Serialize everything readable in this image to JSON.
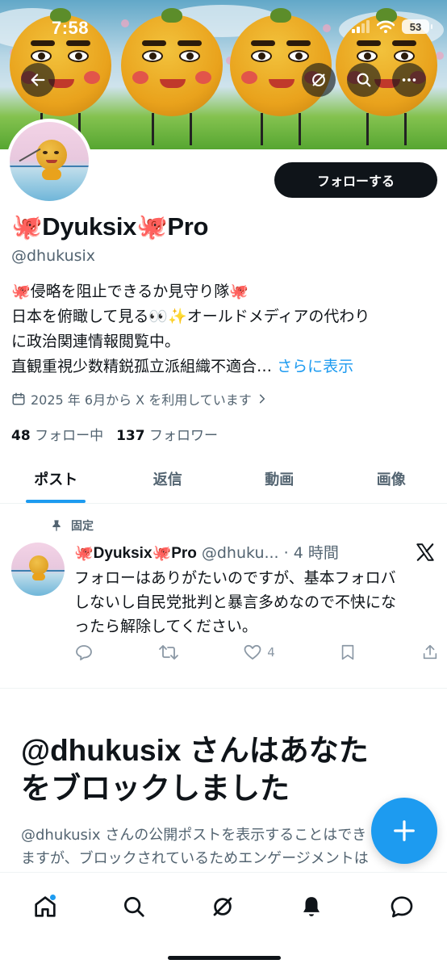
{
  "status_bar": {
    "time": "7:58",
    "battery": "53"
  },
  "profile": {
    "display_name": "🐙Dyuksix🐙Pro",
    "handle": "@dhukusix",
    "follow_label": "フォローする",
    "bio_lines": [
      "🐙侵略を阻止できるか見守り隊🐙",
      "日本を俯瞰して見る👀✨オールドメディアの代わり",
      "に政治関連情報閲覧中。",
      "直観重視少数精鋭孤立派組織不適合…"
    ],
    "bio_more": "さらに表示",
    "joined": "2025 年 6月から X を利用しています",
    "following_count": "48",
    "following_label": "フォロー中",
    "followers_count": "137",
    "followers_label": "フォロワー"
  },
  "tabs": [
    {
      "label": "ポスト",
      "active": true
    },
    {
      "label": "返信",
      "active": false
    },
    {
      "label": "動画",
      "active": false
    },
    {
      "label": "画像",
      "active": false
    }
  ],
  "pinned_post": {
    "pinned_label": "固定",
    "name": "🐙Dyuksix🐙Pro",
    "handle": "@dhuku...",
    "time": "· 4 時間",
    "text_lines": [
      "フォローはありがたいのですが、基本フォロバ",
      "しないし自民党批判と暴言多めなので不快にな",
      "ったら解除してください。"
    ],
    "like_count": "4"
  },
  "blocked": {
    "title_lines": [
      "@dhukusix さんはあなた",
      "をブロックしました"
    ],
    "desc_lines": [
      "@dhukusix さんの公開ポストを表示することはでき",
      "ますが、ブロックされているためエンゲージメントは"
    ]
  },
  "icons": {
    "back": "back-arrow-icon",
    "grok": "grok-icon",
    "search": "search-icon",
    "more": "more-icon",
    "calendar": "calendar-icon",
    "pin": "pin-icon",
    "x_logo": "x-logo-icon",
    "reply": "reply-icon",
    "repost": "repost-icon",
    "like": "heart-icon",
    "bookmark": "bookmark-icon",
    "share": "share-icon",
    "compose": "plus-icon",
    "nav_home": "home-icon",
    "nav_search": "search-icon",
    "nav_grok": "grok-icon",
    "nav_notifications": "bell-icon",
    "nav_messages": "message-icon"
  },
  "colors": {
    "accent": "#1d9bf0",
    "text": "#0f1419",
    "secondary": "#536471",
    "follow_button": "#0f1419"
  }
}
